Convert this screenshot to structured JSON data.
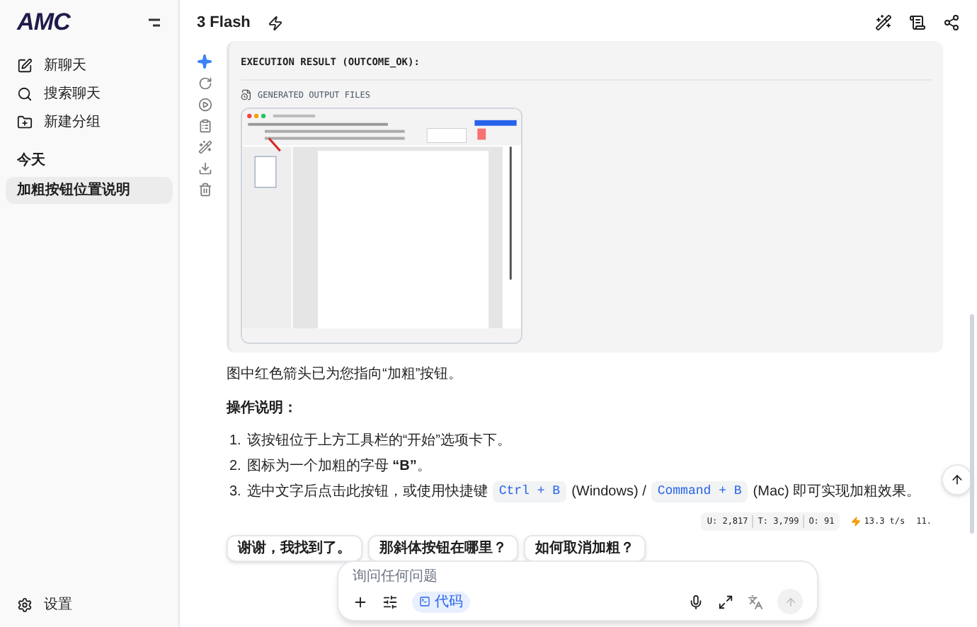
{
  "sidebar": {
    "logo": "AMC",
    "actions": [
      {
        "kind": "new",
        "label": "新聊天"
      },
      {
        "kind": "search",
        "label": "搜索聊天"
      },
      {
        "kind": "folder",
        "label": "新建分组"
      }
    ],
    "section": "今天",
    "conversations": [
      {
        "title": "加粗按钮位置说明",
        "selected": true
      }
    ],
    "settings": "设置"
  },
  "header": {
    "model": "3 Flash"
  },
  "message": {
    "result_title": "EXECUTION RESULT (OUTCOME_OK):",
    "files_label": "GENERATED OUTPUT FILES",
    "paragraph": "图中红色箭头已为您指向“加粗”按钮。",
    "heading": "操作说明：",
    "steps": [
      {
        "number": "1.",
        "parts": [
          {
            "kind": "text",
            "text": "该按钮位于上方工具栏的“开始”选项卡下。"
          }
        ]
      },
      {
        "number": "2.",
        "parts": [
          {
            "kind": "text",
            "text": "图标为一个加粗的字母 **“B”**。"
          }
        ]
      },
      {
        "number": "3.",
        "parts": [
          {
            "kind": "text",
            "text": "选中文字后点击此按钮，或使用快捷键"
          },
          {
            "kind": "kbd",
            "text": "Ctrl + B"
          },
          {
            "kind": "text",
            "text": "(Windows) /"
          },
          {
            "kind": "kbd",
            "text": "Command + B"
          },
          {
            "kind": "text",
            "text": "(Mac) 即可实现加粗效果。"
          }
        ]
      }
    ],
    "stats": [
      "U: 2,817",
      "T: 3,799",
      "O: 91"
    ],
    "speed": "13.3 t/s",
    "extra": "11."
  },
  "suggestions": [
    "谢谢，我找到了。",
    "那斜体按钮在哪里？",
    "如何取消加粗？"
  ],
  "composer": {
    "placeholder": "询问任何问题",
    "tool": "代码"
  }
}
